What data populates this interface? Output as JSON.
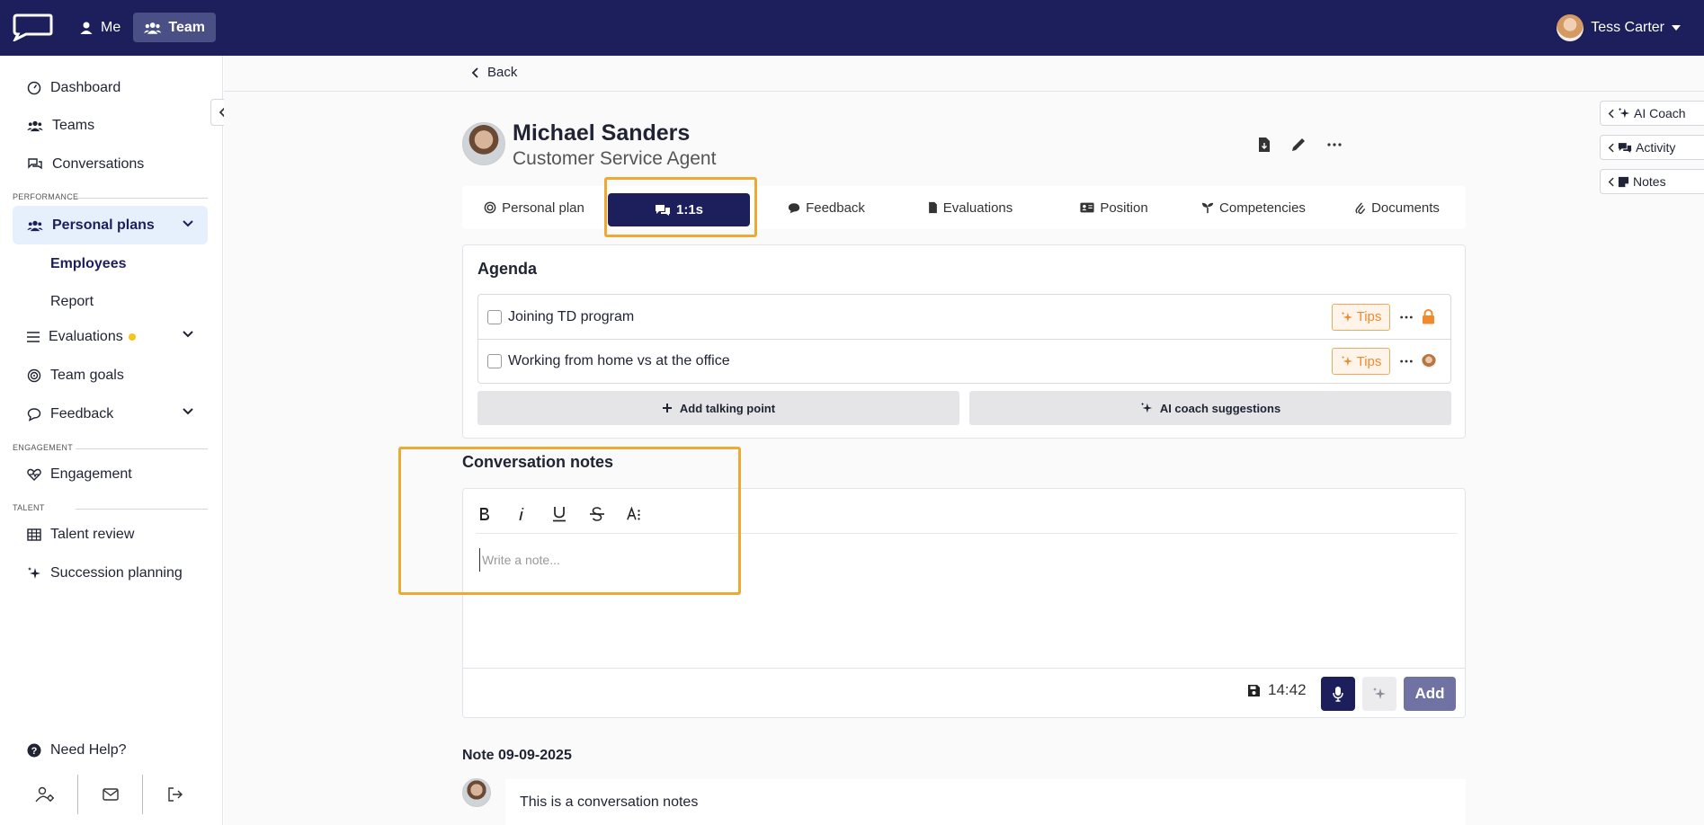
{
  "topbar": {
    "me_label": "Me",
    "team_label": "Team",
    "user_name": "Tess Carter"
  },
  "sidebar": {
    "dashboard": "Dashboard",
    "teams": "Teams",
    "conversations": "Conversations",
    "section_performance": "PERFORMANCE",
    "personal_plans": "Personal plans",
    "employees": "Employees",
    "report": "Report",
    "evaluations": "Evaluations",
    "team_goals": "Team goals",
    "feedback": "Feedback",
    "section_engagement": "ENGAGEMENT",
    "engagement": "Engagement",
    "section_talent": "TALENT",
    "talent_review": "Talent review",
    "succession_planning": "Succession planning",
    "need_help": "Need Help?"
  },
  "main": {
    "back_label": "Back",
    "employee": {
      "name": "Michael Sanders",
      "role": "Customer Service Agent"
    },
    "tabs": [
      {
        "label": "Personal plan"
      },
      {
        "label": "1:1s"
      },
      {
        "label": "Feedback"
      },
      {
        "label": "Evaluations"
      },
      {
        "label": "Position"
      },
      {
        "label": "Competencies"
      },
      {
        "label": "Documents"
      }
    ],
    "agenda": {
      "title": "Agenda",
      "items": [
        {
          "text": "Joining TD program",
          "tips_label": "Tips"
        },
        {
          "text": "Working from home vs at the office",
          "tips_label": "Tips"
        }
      ],
      "add_talking_point": "Add talking point",
      "ai_suggestions": "AI coach suggestions"
    },
    "notes": {
      "title": "Conversation notes",
      "placeholder": "Write a note...",
      "timer": "14:42",
      "add_label": "Add"
    },
    "previous_note": {
      "date_label": "Note 09-09-2025",
      "text": "This is a conversation notes"
    }
  },
  "right_panels": {
    "ai_coach": "AI Coach",
    "activity": "Activity",
    "notes": "Notes"
  },
  "colors": {
    "navy": "#1c1f5c",
    "accent_orange": "#f08a2c",
    "highlight": "#f0a830",
    "active_bg": "#e5f0fc"
  }
}
